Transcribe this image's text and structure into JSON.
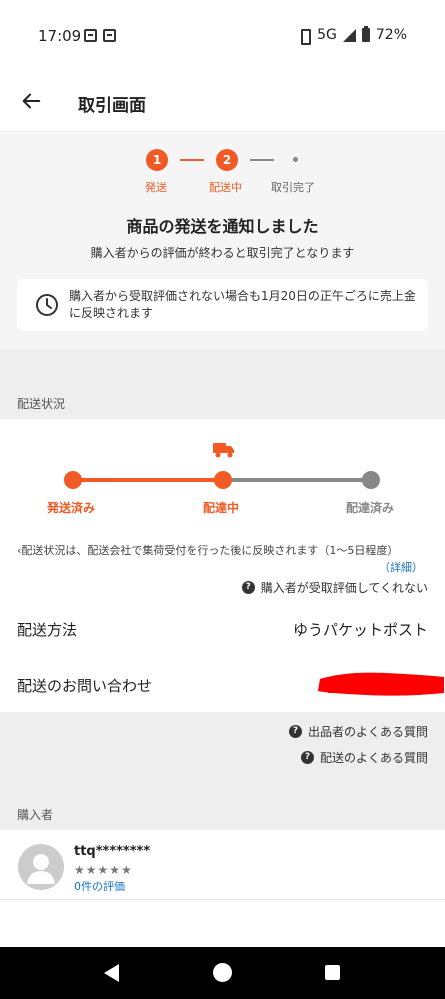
{
  "status_bar": {
    "time": "17:09",
    "network": "5G",
    "battery": "72%"
  },
  "app_bar": {
    "title": "取引画面"
  },
  "steps": [
    {
      "number": "1",
      "label": "発送"
    },
    {
      "number": "2",
      "label": "配送中"
    },
    {
      "number": "",
      "label": "取引完了"
    }
  ],
  "notice": {
    "title": "商品の発送を通知しました",
    "subtitle": "購入者からの評価が終わると取引完了となります",
    "info": "購入者から受取評価されない場合も1月20日の正午ごろに売上金に反映されます"
  },
  "shipping": {
    "section_label": "配送状況",
    "progress": [
      "発送済み",
      "配達中",
      "配達済み"
    ],
    "note": "‹配送状況は、配送会社で集荷受付を行った後に反映されます（1〜5日程度）",
    "detail_link": "（詳細）",
    "help_not_received": "購入者が受取評価してくれない",
    "method_label": "配送方法",
    "method_value": "ゆうパケットポスト",
    "inquiry_label": "配送のお問い合わせ"
  },
  "faq": {
    "seller_faq": "出品者のよくある質問",
    "shipping_faq": "配送のよくある質問"
  },
  "buyer": {
    "section_label": "購入者",
    "name": "ttq********",
    "stars": "★★★★★",
    "rating_text": "0件の評価"
  },
  "colors": {
    "accent": "#f15a24",
    "inactive": "#888888",
    "link": "#1a73c9"
  }
}
